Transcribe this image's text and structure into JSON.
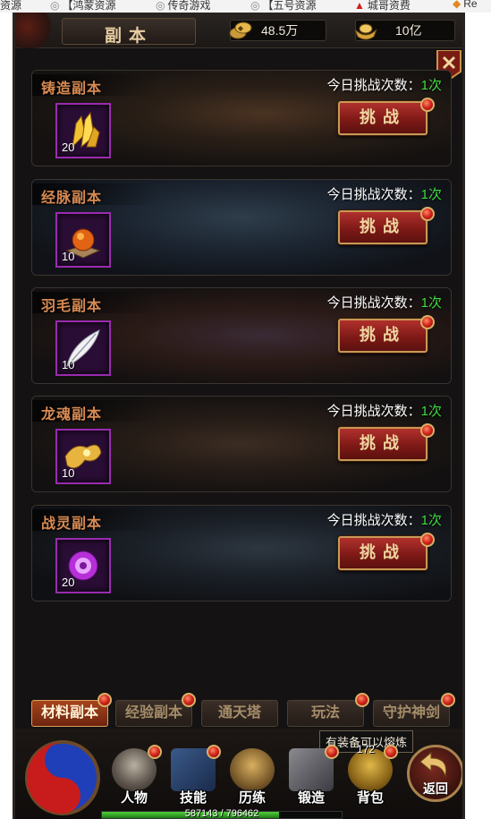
{
  "bookmarks": [
    {
      "label": "资源",
      "icon": "globe-icon"
    },
    {
      "label": "【鸿蒙资源",
      "icon": "globe-icon"
    },
    {
      "label": "传奇游戏",
      "icon": "globe-icon"
    },
    {
      "label": "【五号资源",
      "icon": "globe-icon"
    },
    {
      "label": "城哥资费",
      "icon": "red-flag-icon"
    },
    {
      "label": "Re",
      "icon": "fox-icon"
    }
  ],
  "header": {
    "title": "副本",
    "gold_value": "48.5万",
    "gold_icon": "gold-coins-icon",
    "ingot_value": "10亿",
    "ingot_icon": "gold-ingot-icon",
    "close_icon": "close-icon"
  },
  "colors": {
    "item_border": "#9a2bb0",
    "count_green": "#3fdb3f",
    "button_red": "#7a1815",
    "name_orange": "#d98a52"
  },
  "dungeons": [
    {
      "name": "铸造副本",
      "challenge_label": "今日挑战次数：",
      "challenge_count": "1次",
      "item_count": "20",
      "item_icon": "gold-crystal-icon",
      "button": "挑战"
    },
    {
      "name": "经脉副本",
      "challenge_label": "今日挑战次数：",
      "challenge_count": "1次",
      "item_count": "10",
      "item_icon": "fire-orb-icon",
      "button": "挑战"
    },
    {
      "name": "羽毛副本",
      "challenge_label": "今日挑战次数：",
      "challenge_count": "1次",
      "item_count": "10",
      "item_icon": "white-feather-icon",
      "button": "挑战"
    },
    {
      "name": "龙魂副本",
      "challenge_label": "今日挑战次数：",
      "challenge_count": "1次",
      "item_count": "10",
      "item_icon": "dragon-soul-icon",
      "button": "挑战"
    },
    {
      "name": "战灵副本",
      "challenge_label": "今日挑战次数：",
      "challenge_count": "1次",
      "item_count": "20",
      "item_icon": "purple-orb-icon",
      "button": "挑战"
    }
  ],
  "tabs": [
    {
      "label": "材料副本",
      "active": true
    },
    {
      "label": "经验副本",
      "active": false
    },
    {
      "label": "通天塔",
      "active": false
    },
    {
      "label": "玩法",
      "active": false
    },
    {
      "label": "守护神剑",
      "active": false
    }
  ],
  "nav": {
    "items": [
      {
        "label": "人物",
        "icon": "character-helmet-icon"
      },
      {
        "label": "技能",
        "icon": "skill-book-icon"
      },
      {
        "label": "历练",
        "icon": "training-armor-icon"
      },
      {
        "label": "锻造",
        "icon": "forge-anvil-icon"
      },
      {
        "label": "背包",
        "icon": "bag-icon"
      }
    ],
    "bag_count": "172",
    "return_label": "返回",
    "tooltip": "有装备可以熔炼",
    "xp_text": "587143 / 796462",
    "xp_fraction": 0.737
  }
}
